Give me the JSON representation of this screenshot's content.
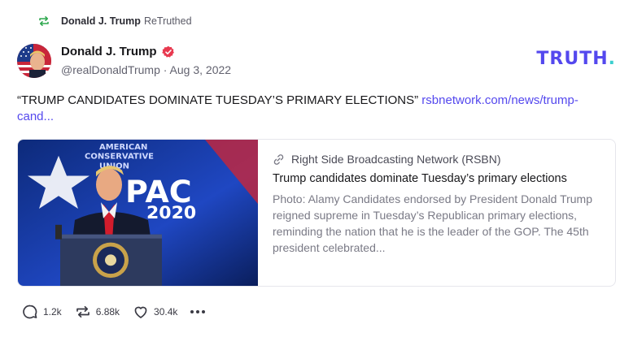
{
  "retruth": {
    "name": "Donald J. Trump",
    "label": "ReTruthed",
    "icon": "retruth-icon"
  },
  "author": {
    "name": "Donald J. Trump",
    "handle": "@realDonaldTrump",
    "separator": "·",
    "date": "Aug 3, 2022",
    "verified_icon": "verified-badge-icon"
  },
  "logo": {
    "text": "TRUTH",
    "dot": ".",
    "brand_color": "#5448ee",
    "dot_color": "#3ccfcf"
  },
  "post": {
    "text": "“TRUMP CANDIDATES DOMINATE TUESDAY’S PRIMARY ELECTIONS”",
    "link": "rsbnetwork.com/news/trump-cand..."
  },
  "card": {
    "source": "Right Side Broadcasting Network (RSBN)",
    "title": "Trump candidates dominate Tuesday’s primary elections",
    "description": "Photo: Alamy Candidates endorsed by President Donald Trump reigned supreme in Tuesday’s Republican primary elections, reminding the nation that he is the leader of the GOP. The 45th president celebrated...",
    "image_text": [
      "AMERICAN",
      "CONSERVATIVE",
      "UNION",
      "PAC",
      "2020"
    ]
  },
  "actions": {
    "replies": "1.2k",
    "retruths": "6.88k",
    "likes": "30.4k"
  }
}
